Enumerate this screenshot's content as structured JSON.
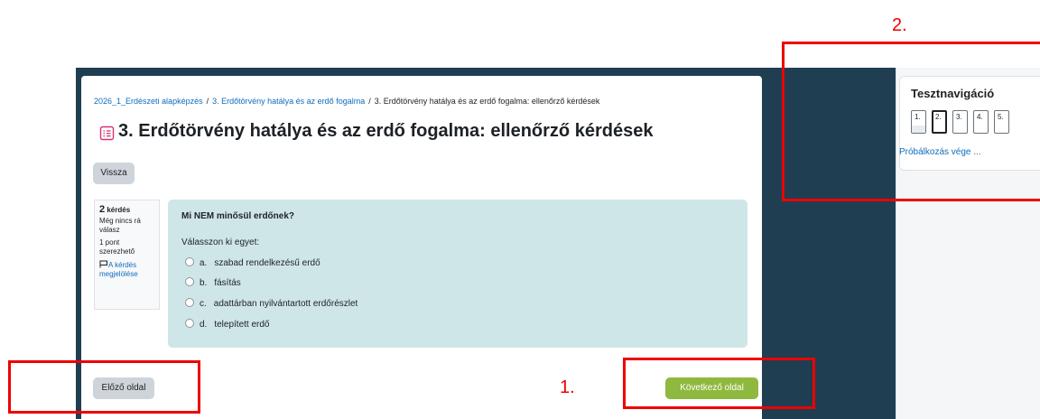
{
  "breadcrumb": {
    "items": [
      {
        "label": "2026_1_Erdészeti alapképzés"
      },
      {
        "label": "3. Erdőtörvény hatálya és az erdő fogalma"
      },
      {
        "label": "3. Erdőtörvény hatálya és az erdő fogalma: ellenőrző kérdések"
      }
    ],
    "separator": "/"
  },
  "page": {
    "title": "3. Erdőtörvény hatálya és az erdő fogalma: ellenőrző kérdések",
    "icon": "quiz-icon"
  },
  "buttons": {
    "back": "Vissza",
    "previous": "Előző oldal",
    "next": "Következő oldal"
  },
  "question_info": {
    "number": "2",
    "number_label": "kérdés",
    "status": "Még nincs rá válasz",
    "points": "1 pont szerezhető",
    "flag_link": "A kérdés megjelölése",
    "flag_icon": "flag-icon"
  },
  "question": {
    "text": "Mi NEM minősül erdőnek?",
    "prompt": "Válasszon ki egyet:",
    "options": [
      {
        "letter": "a.",
        "label": "szabad rendelkezésű erdő"
      },
      {
        "letter": "b.",
        "label": "fásítás"
      },
      {
        "letter": "c.",
        "label": "adattárban nyilvántartott erdőrészlet"
      },
      {
        "letter": "d.",
        "label": "telepített erdő"
      }
    ]
  },
  "quiz_navigation": {
    "title": "Tesztnavigáció",
    "questions": [
      "1.",
      "2.",
      "3.",
      "4.",
      "5."
    ],
    "current": 2,
    "finish_link": "Próbálkozás vége ..."
  },
  "annotations": {
    "label_1": "1.",
    "label_2": "2.",
    "color": "#ee0000"
  },
  "colors": {
    "dark_background": "#1f3e52",
    "question_background": "#cfe6e8",
    "next_button": "#8fb93e",
    "link": "#0f6cbf"
  }
}
